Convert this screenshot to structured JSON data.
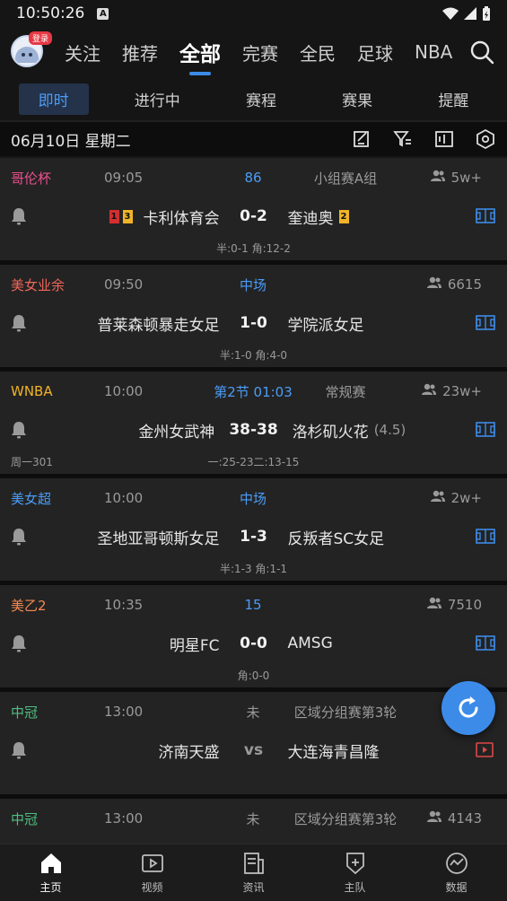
{
  "status": {
    "time": "10:50:26",
    "notif_icon": "A"
  },
  "top_nav": {
    "login_badge": "登录",
    "tabs": [
      {
        "label": "关注",
        "active": false
      },
      {
        "label": "推荐",
        "active": false
      },
      {
        "label": "全部",
        "active": true
      },
      {
        "label": "完赛",
        "active": false
      },
      {
        "label": "全民",
        "active": false
      },
      {
        "label": "足球",
        "active": false
      },
      {
        "label": "NBA",
        "active": false
      }
    ]
  },
  "sub_tabs": [
    {
      "label": "即时",
      "active": true
    },
    {
      "label": "进行中",
      "active": false
    },
    {
      "label": "赛程",
      "active": false
    },
    {
      "label": "赛果",
      "active": false
    },
    {
      "label": "提醒",
      "active": false
    }
  ],
  "date_bar": {
    "date": "06月10日 星期二"
  },
  "matches": [
    {
      "league": "哥伦杯",
      "league_color": "#e8508c",
      "time": "09:05",
      "status": "86",
      "status_color": "#4b9cf6",
      "round": "小组赛A组",
      "fans": "5w+",
      "home": "卡利体育会",
      "home_red": "1",
      "home_yellow": "3",
      "score": "0-2",
      "away": "奎迪奥",
      "away_yellow": "2",
      "odds": "",
      "half": "半:0-1 角:12-2",
      "extra": "",
      "icon": "field"
    },
    {
      "league": "美女业余",
      "league_color": "#f0665a",
      "time": "09:50",
      "status": "中场",
      "status_color": "#4b9cf6",
      "round": "",
      "fans": "6615",
      "home": "普莱森顿暴走女足",
      "score": "1-0",
      "away": "学院派女足",
      "odds": "",
      "half": "半:1-0 角:4-0",
      "extra": "",
      "icon": "field"
    },
    {
      "league": "WNBA",
      "league_color": "#f0b428",
      "time": "10:00",
      "status": "第2节 01:03",
      "status_color": "#4b9cf6",
      "round": "常规赛",
      "fans": "23w+",
      "home": "金州女武神",
      "score": "38-38",
      "away": "洛杉矶火花",
      "odds": "(4.5)",
      "half": "一:25-23二:13-15",
      "extra": "周一301",
      "icon": "field"
    },
    {
      "league": "美女超",
      "league_color": "#4b9cf6",
      "time": "10:00",
      "status": "中场",
      "status_color": "#4b9cf6",
      "round": "",
      "fans": "2w+",
      "home": "圣地亚哥顿斯女足",
      "score": "1-3",
      "away": "反叛者SC女足",
      "odds": "",
      "half": "半:1-3 角:1-1",
      "extra": "",
      "icon": "field"
    },
    {
      "league": "美乙2",
      "league_color": "#f28a52",
      "time": "10:35",
      "status": "15",
      "status_color": "#4b9cf6",
      "round": "",
      "fans": "7510",
      "home": "明星FC",
      "score": "0-0",
      "away": "AMSG",
      "odds": "",
      "half": "角:0-0",
      "extra": "",
      "icon": "field"
    },
    {
      "league": "中冠",
      "league_color": "#4fbf80",
      "time": "13:00",
      "status": "未",
      "status_color": "#9a9a9a",
      "round": "区域分组赛第3轮",
      "fans": "",
      "home": "济南天盛",
      "score": "vs",
      "away": "大连海青昌隆",
      "odds": "",
      "half": "",
      "extra": "",
      "icon": "video"
    },
    {
      "league": "中冠",
      "league_color": "#4fbf80",
      "time": "13:00",
      "status": "未",
      "status_color": "#9a9a9a",
      "round": "区域分组赛第3轮",
      "fans": "4143",
      "home": "",
      "score": "",
      "away": "",
      "odds": "",
      "half": "",
      "extra": "",
      "icon": ""
    }
  ],
  "bottom_nav": [
    {
      "label": "主页",
      "icon": "home-icon",
      "active": true
    },
    {
      "label": "视频",
      "icon": "video-icon",
      "active": false
    },
    {
      "label": "资讯",
      "icon": "news-icon",
      "active": false
    },
    {
      "label": "主队",
      "icon": "shield-icon",
      "active": false
    },
    {
      "label": "数据",
      "icon": "chart-icon",
      "active": false
    }
  ],
  "colors": {
    "accent": "#3d8be8",
    "background": "#151515",
    "card": "#232323"
  }
}
